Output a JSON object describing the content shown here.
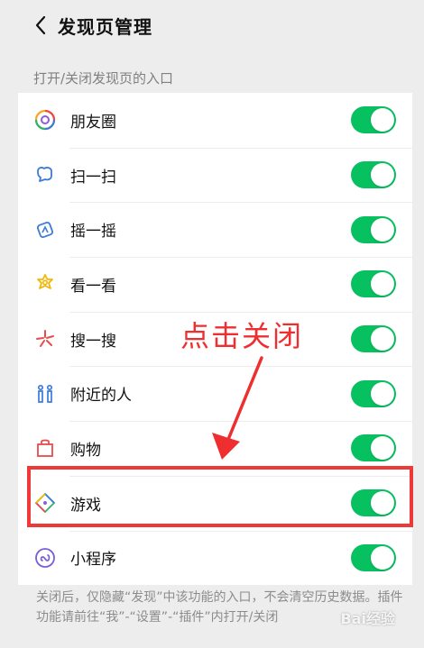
{
  "header": {
    "title": "发现页管理",
    "back_icon": "chevron-left-icon"
  },
  "section_label": "打开/关闭发现页的入口",
  "items": [
    {
      "label": "朋友圈",
      "icon": "moments-icon",
      "enabled": true
    },
    {
      "label": "扫一扫",
      "icon": "scan-icon",
      "enabled": true
    },
    {
      "label": "摇一摇",
      "icon": "shake-icon",
      "enabled": true
    },
    {
      "label": "看一看",
      "icon": "top-stories-icon",
      "enabled": true
    },
    {
      "label": "搜一搜",
      "icon": "search-icon",
      "enabled": true
    },
    {
      "label": "附近的人",
      "icon": "people-nearby-icon",
      "enabled": true
    },
    {
      "label": "购物",
      "icon": "shopping-bag-icon",
      "enabled": true
    },
    {
      "label": "游戏",
      "icon": "games-icon",
      "enabled": true
    },
    {
      "label": "小程序",
      "icon": "mini-programs-icon",
      "enabled": true
    }
  ],
  "annotation": {
    "text": "点击关闭",
    "color": "#ef2f2f"
  },
  "footer_note": "关闭后，仅隐藏“发现”中该功能的入口，不会清空历史数据。插件功能请前往“我”-“设置”-“插件”内打开/关闭",
  "watermark": "Bai经验",
  "colors": {
    "toggle_on": "#07c160",
    "background": "#ededed",
    "highlight": "#ef3838"
  }
}
